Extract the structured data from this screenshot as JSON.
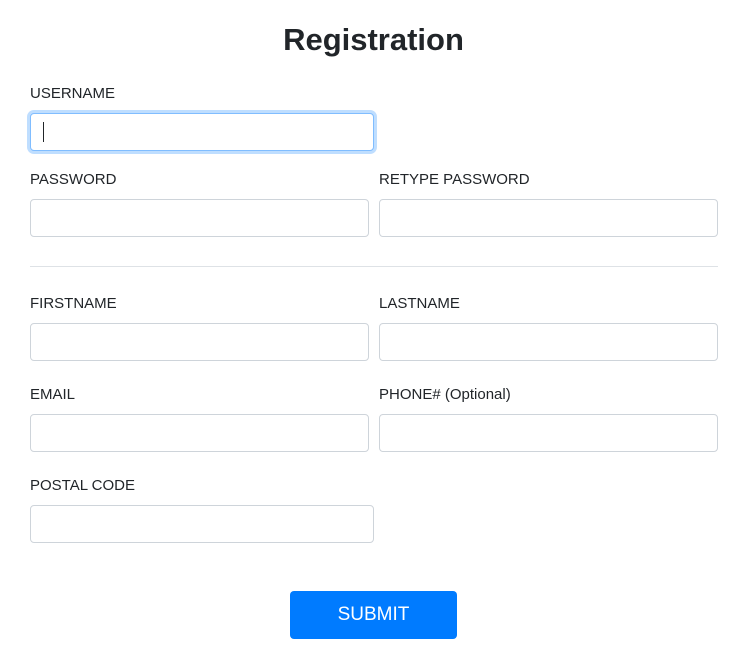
{
  "form": {
    "title": "Registration",
    "username": {
      "label": "USERNAME",
      "value": "",
      "placeholder": ""
    },
    "password": {
      "label": "PASSWORD",
      "value": "",
      "placeholder": ""
    },
    "retype_password": {
      "label": "RETYPE PASSWORD",
      "value": "",
      "placeholder": ""
    },
    "firstname": {
      "label": "FIRSTNAME",
      "value": "",
      "placeholder": ""
    },
    "lastname": {
      "label": "LASTNAME",
      "value": "",
      "placeholder": ""
    },
    "email": {
      "label": "EMAIL",
      "value": "",
      "placeholder": ""
    },
    "phone": {
      "label": "PHONE# (Optional)",
      "value": "",
      "placeholder": ""
    },
    "postal_code": {
      "label": "POSTAL CODE",
      "value": "",
      "placeholder": ""
    },
    "submit_label": "SUBMIT"
  },
  "colors": {
    "primary": "#007bff",
    "focus_border": "#80bdff",
    "input_border": "#ced4da",
    "divider": "#dee2e6",
    "text": "#212529"
  }
}
